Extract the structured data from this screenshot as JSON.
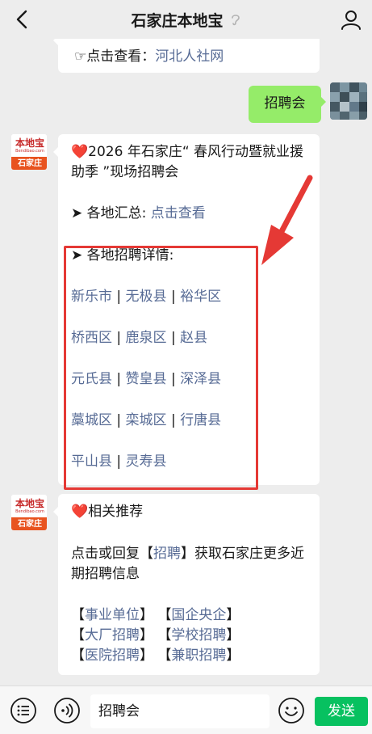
{
  "header": {
    "title": "石家庄本地宝"
  },
  "logo": {
    "main": "本地宝",
    "sub": "Bendibao.com",
    "bottom": "石家庄"
  },
  "msg_top": {
    "prefix": "☞点击查看：",
    "link": "河北人社网"
  },
  "msg_user": {
    "text": "招聘会"
  },
  "msg_main": {
    "heart": "❤️",
    "title": "2026 年石家庄“ 春风行动暨就业援助季 ”现场招聘会",
    "summary_label": "➤ 各地汇总:",
    "summary_link": "点击查看",
    "details_label": "➤ 各地招聘详情:",
    "rows": [
      [
        "新乐市",
        "无极县",
        "裕华区"
      ],
      [
        "桥西区",
        "鹿泉区",
        "赵县"
      ],
      [
        "元氏县",
        "赞皇县",
        "深泽县"
      ],
      [
        "藁城区",
        "栾城区",
        "行唐县"
      ],
      [
        "平山县",
        "灵寿县"
      ]
    ]
  },
  "msg_related": {
    "heart": "❤️",
    "title": "相关推荐",
    "line1_pre": "点击或回复【",
    "line1_link": "招聘",
    "line1_post": "】获取石家庄更多近期招聘信息",
    "tags": [
      [
        "事业单位",
        "国企央企"
      ],
      [
        "大厂招聘",
        "学校招聘"
      ],
      [
        "医院招聘",
        "兼职招聘"
      ]
    ]
  },
  "input": {
    "value": "招聘会",
    "send_label": "发送"
  },
  "colors": {
    "link": "#576b95",
    "send": "#07c160",
    "highlight": "#e53935",
    "out_bubble": "#95ec69"
  }
}
